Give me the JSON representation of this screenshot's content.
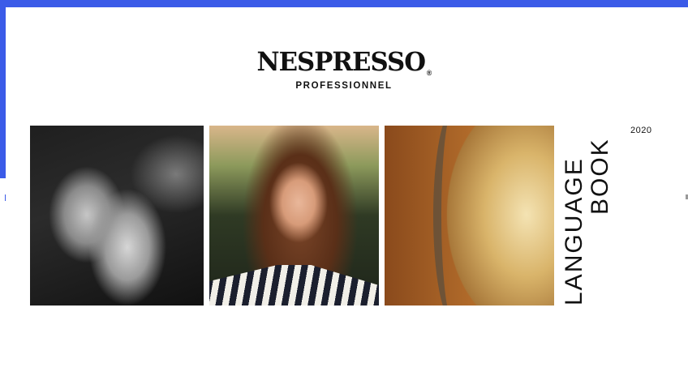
{
  "brand": {
    "name": "NESPRESSO",
    "trademark": "®",
    "subtitle": "PROFESSIONNEL"
  },
  "cover": {
    "title_line1": "LANGUAGE",
    "title_line2": "BOOK",
    "year": "2020"
  },
  "photos": [
    {
      "subject": "hands"
    },
    {
      "subject": "woman-portrait"
    },
    {
      "subject": "golden-capsule"
    }
  ],
  "colors": {
    "frame_accent": "#3b5be8",
    "text": "#111111",
    "background": "#ffffff"
  }
}
